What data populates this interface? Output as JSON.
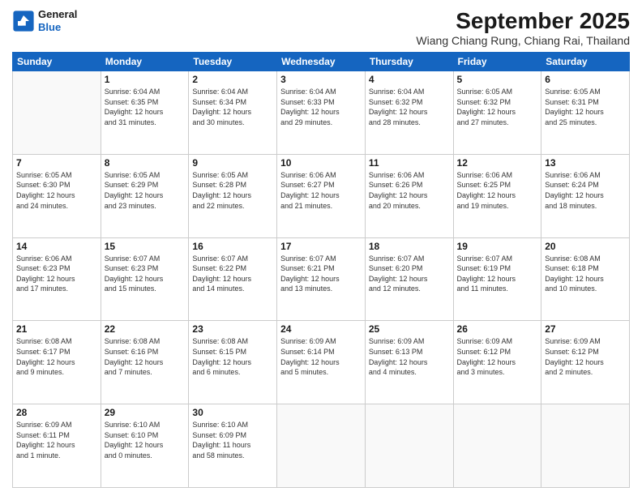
{
  "logo": {
    "line1": "General",
    "line2": "Blue"
  },
  "title": "September 2025",
  "location": "Wiang Chiang Rung, Chiang Rai, Thailand",
  "days_of_week": [
    "Sunday",
    "Monday",
    "Tuesday",
    "Wednesday",
    "Thursday",
    "Friday",
    "Saturday"
  ],
  "weeks": [
    [
      {
        "day": "",
        "info": ""
      },
      {
        "day": "1",
        "info": "Sunrise: 6:04 AM\nSunset: 6:35 PM\nDaylight: 12 hours\nand 31 minutes."
      },
      {
        "day": "2",
        "info": "Sunrise: 6:04 AM\nSunset: 6:34 PM\nDaylight: 12 hours\nand 30 minutes."
      },
      {
        "day": "3",
        "info": "Sunrise: 6:04 AM\nSunset: 6:33 PM\nDaylight: 12 hours\nand 29 minutes."
      },
      {
        "day": "4",
        "info": "Sunrise: 6:04 AM\nSunset: 6:32 PM\nDaylight: 12 hours\nand 28 minutes."
      },
      {
        "day": "5",
        "info": "Sunrise: 6:05 AM\nSunset: 6:32 PM\nDaylight: 12 hours\nand 27 minutes."
      },
      {
        "day": "6",
        "info": "Sunrise: 6:05 AM\nSunset: 6:31 PM\nDaylight: 12 hours\nand 25 minutes."
      }
    ],
    [
      {
        "day": "7",
        "info": "Sunrise: 6:05 AM\nSunset: 6:30 PM\nDaylight: 12 hours\nand 24 minutes."
      },
      {
        "day": "8",
        "info": "Sunrise: 6:05 AM\nSunset: 6:29 PM\nDaylight: 12 hours\nand 23 minutes."
      },
      {
        "day": "9",
        "info": "Sunrise: 6:05 AM\nSunset: 6:28 PM\nDaylight: 12 hours\nand 22 minutes."
      },
      {
        "day": "10",
        "info": "Sunrise: 6:06 AM\nSunset: 6:27 PM\nDaylight: 12 hours\nand 21 minutes."
      },
      {
        "day": "11",
        "info": "Sunrise: 6:06 AM\nSunset: 6:26 PM\nDaylight: 12 hours\nand 20 minutes."
      },
      {
        "day": "12",
        "info": "Sunrise: 6:06 AM\nSunset: 6:25 PM\nDaylight: 12 hours\nand 19 minutes."
      },
      {
        "day": "13",
        "info": "Sunrise: 6:06 AM\nSunset: 6:24 PM\nDaylight: 12 hours\nand 18 minutes."
      }
    ],
    [
      {
        "day": "14",
        "info": "Sunrise: 6:06 AM\nSunset: 6:23 PM\nDaylight: 12 hours\nand 17 minutes."
      },
      {
        "day": "15",
        "info": "Sunrise: 6:07 AM\nSunset: 6:23 PM\nDaylight: 12 hours\nand 15 minutes."
      },
      {
        "day": "16",
        "info": "Sunrise: 6:07 AM\nSunset: 6:22 PM\nDaylight: 12 hours\nand 14 minutes."
      },
      {
        "day": "17",
        "info": "Sunrise: 6:07 AM\nSunset: 6:21 PM\nDaylight: 12 hours\nand 13 minutes."
      },
      {
        "day": "18",
        "info": "Sunrise: 6:07 AM\nSunset: 6:20 PM\nDaylight: 12 hours\nand 12 minutes."
      },
      {
        "day": "19",
        "info": "Sunrise: 6:07 AM\nSunset: 6:19 PM\nDaylight: 12 hours\nand 11 minutes."
      },
      {
        "day": "20",
        "info": "Sunrise: 6:08 AM\nSunset: 6:18 PM\nDaylight: 12 hours\nand 10 minutes."
      }
    ],
    [
      {
        "day": "21",
        "info": "Sunrise: 6:08 AM\nSunset: 6:17 PM\nDaylight: 12 hours\nand 9 minutes."
      },
      {
        "day": "22",
        "info": "Sunrise: 6:08 AM\nSunset: 6:16 PM\nDaylight: 12 hours\nand 7 minutes."
      },
      {
        "day": "23",
        "info": "Sunrise: 6:08 AM\nSunset: 6:15 PM\nDaylight: 12 hours\nand 6 minutes."
      },
      {
        "day": "24",
        "info": "Sunrise: 6:09 AM\nSunset: 6:14 PM\nDaylight: 12 hours\nand 5 minutes."
      },
      {
        "day": "25",
        "info": "Sunrise: 6:09 AM\nSunset: 6:13 PM\nDaylight: 12 hours\nand 4 minutes."
      },
      {
        "day": "26",
        "info": "Sunrise: 6:09 AM\nSunset: 6:12 PM\nDaylight: 12 hours\nand 3 minutes."
      },
      {
        "day": "27",
        "info": "Sunrise: 6:09 AM\nSunset: 6:12 PM\nDaylight: 12 hours\nand 2 minutes."
      }
    ],
    [
      {
        "day": "28",
        "info": "Sunrise: 6:09 AM\nSunset: 6:11 PM\nDaylight: 12 hours\nand 1 minute."
      },
      {
        "day": "29",
        "info": "Sunrise: 6:10 AM\nSunset: 6:10 PM\nDaylight: 12 hours\nand 0 minutes."
      },
      {
        "day": "30",
        "info": "Sunrise: 6:10 AM\nSunset: 6:09 PM\nDaylight: 11 hours\nand 58 minutes."
      },
      {
        "day": "",
        "info": ""
      },
      {
        "day": "",
        "info": ""
      },
      {
        "day": "",
        "info": ""
      },
      {
        "day": "",
        "info": ""
      }
    ]
  ]
}
